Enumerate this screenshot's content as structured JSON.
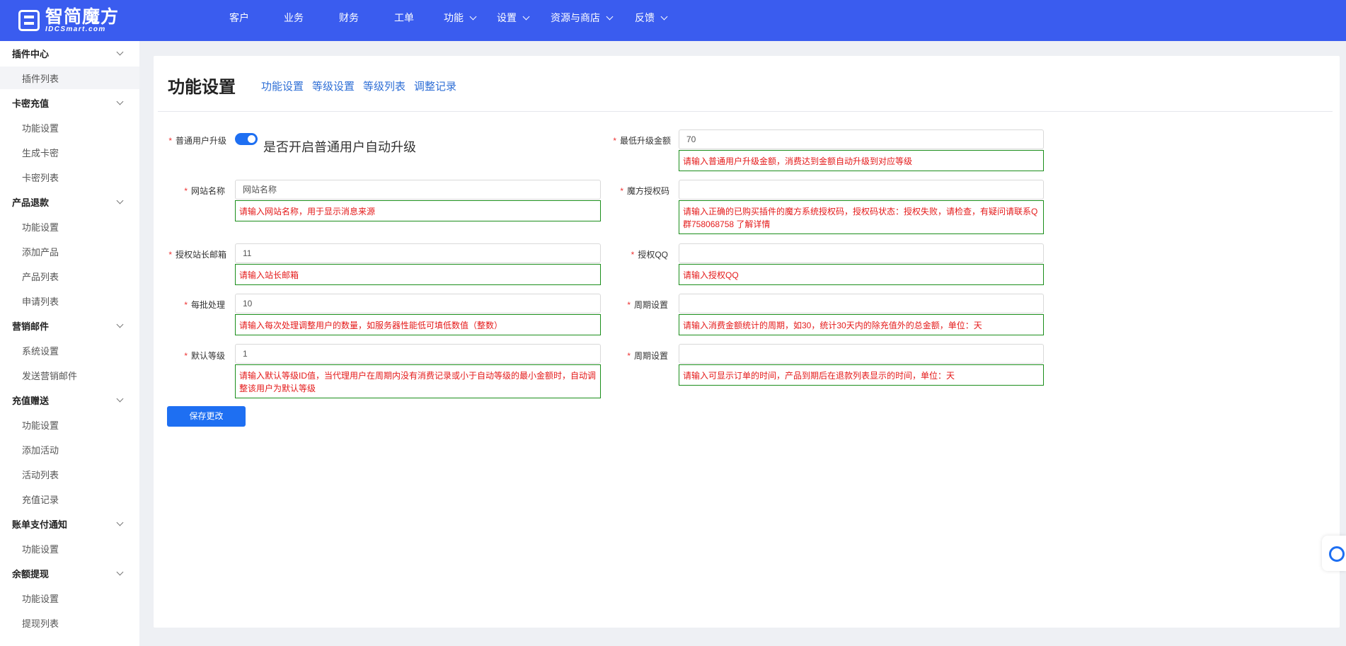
{
  "brand": {
    "name_cn": "智简魔方",
    "name_en": "IDCSmart.com"
  },
  "nav": [
    {
      "label": "客户",
      "dropdown": false
    },
    {
      "label": "业务",
      "dropdown": false
    },
    {
      "label": "财务",
      "dropdown": false
    },
    {
      "label": "工单",
      "dropdown": false
    },
    {
      "label": "功能",
      "dropdown": true
    },
    {
      "label": "设置",
      "dropdown": true
    },
    {
      "label": "资源与商店",
      "dropdown": true
    },
    {
      "label": "反馈",
      "dropdown": true
    }
  ],
  "sidebar": {
    "groups": [
      {
        "label": "插件中心",
        "items": [
          "插件列表"
        ]
      },
      {
        "label": "卡密充值",
        "items": [
          "功能设置",
          "生成卡密",
          "卡密列表"
        ]
      },
      {
        "label": "产品退款",
        "items": [
          "功能设置",
          "添加产品",
          "产品列表",
          "申请列表"
        ]
      },
      {
        "label": "营销邮件",
        "items": [
          "系统设置",
          "发送营销邮件"
        ]
      },
      {
        "label": "充值赠送",
        "items": [
          "功能设置",
          "添加活动",
          "活动列表",
          "充值记录"
        ]
      },
      {
        "label": "账单支付通知",
        "items": [
          "功能设置"
        ]
      },
      {
        "label": "余额提现",
        "items": [
          "功能设置",
          "提现列表"
        ]
      }
    ]
  },
  "page": {
    "title": "功能设置",
    "tabs": [
      "功能设置",
      "等级设置",
      "等级列表",
      "调整记录"
    ]
  },
  "form": {
    "auto_upgrade": {
      "label": "普通用户升级",
      "enabled": true,
      "switch_text": "是否开启普通用户自动升级"
    },
    "min_upgrade_amount": {
      "label": "最低升级金额",
      "value": "70",
      "hint": "请输入普通用户升级金额，消费达到金额自动升级到对应等级"
    },
    "site_name": {
      "label": "网站名称",
      "value": "网站名称",
      "hint": "请输入网站名称，用于显示消息来源"
    },
    "license_code": {
      "label": "魔方授权码",
      "value": "",
      "hint": "请输入正确的已购买插件的魔方系统授权码，授权码状态：授权失败，请检查，有疑问请联系Q群758068758 了解详情"
    },
    "admin_email": {
      "label": "授权站长邮箱",
      "value": "11",
      "hint": "请输入站长邮箱"
    },
    "license_qq": {
      "label": "授权QQ",
      "value": "",
      "hint": "请输入授权QQ"
    },
    "batch_size": {
      "label": "每批处理",
      "value": "10",
      "hint": "请输入每次处理调整用户的数量，如服务器性能低可填低数值（整数）"
    },
    "period_1": {
      "label": "周期设置",
      "value": "",
      "hint": "请输入消费金额统计的周期，如30，统计30天内的除充值外的总金额，单位：天"
    },
    "default_level": {
      "label": "默认等级",
      "value": "1",
      "hint": "请输入默认等级ID值，当代理用户在周期内没有消费记录或小于自动等级的最小金额时，自动调整该用户为默认等级"
    },
    "period_2": {
      "label": "周期设置",
      "value": "",
      "hint": "请输入可显示订单的时间，产品到期后在退款列表显示的时间，单位：天"
    },
    "save_label": "保存更改"
  },
  "colors": {
    "topbar": "#3a5cef",
    "primary": "#1e6ff2",
    "tab_link": "#2f6fd6",
    "hint_border": "#1b8e1b",
    "hint_text": "#e41a1a",
    "required": "#e33"
  }
}
